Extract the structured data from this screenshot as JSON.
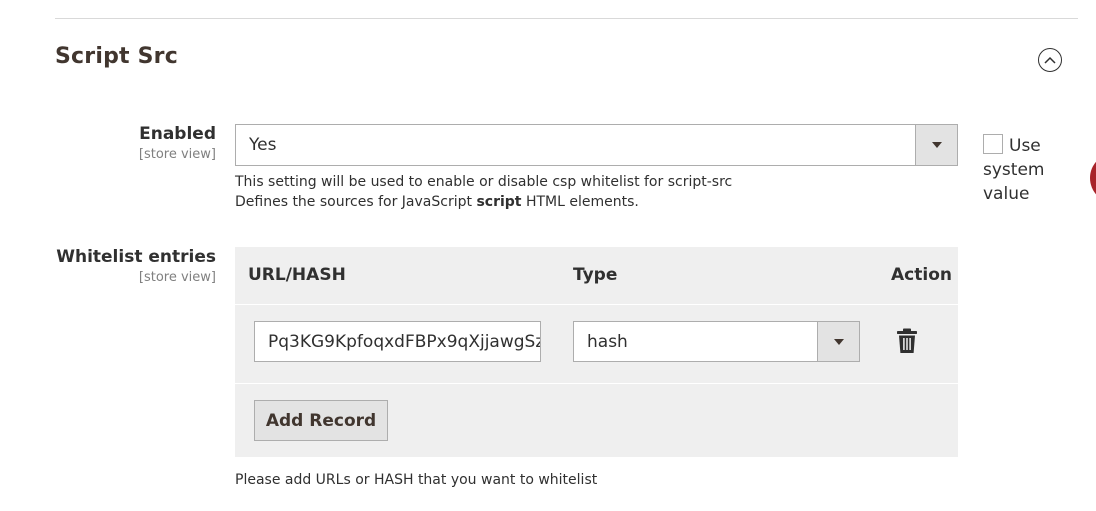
{
  "section": {
    "title": "Script Src",
    "collapse_icon": "chevron-up-circle-icon"
  },
  "enabled": {
    "label": "Enabled",
    "scope": "[store view]",
    "value": "Yes",
    "note_line1": "This setting will be used to enable or disable csp whitelist for script-src",
    "note_line2_before": "Defines the sources for JavaScript ",
    "note_line2_bold": "script",
    "note_line2_after": " HTML elements.",
    "use_system_label": "Use system value",
    "use_system_checked": false
  },
  "whitelist": {
    "label": "Whitelist entries",
    "scope": "[store view]",
    "columns": [
      "URL/HASH",
      "Type",
      "Action"
    ],
    "rows": [
      {
        "url_hash": "Pq3KG9KpfoqxdFBPx9qXjjawgSz",
        "type": "hash",
        "action_icon": "trash-icon"
      }
    ],
    "add_button_label": "Add Record",
    "footer_note": "Please add URLs or HASH that you want to whitelist"
  },
  "colors": {
    "text": "#303030",
    "title": "#41362f",
    "border": "#adadad",
    "grid_bg": "#efefef",
    "button_bg": "#e3e3e3",
    "accent_red": "#a8232a"
  }
}
